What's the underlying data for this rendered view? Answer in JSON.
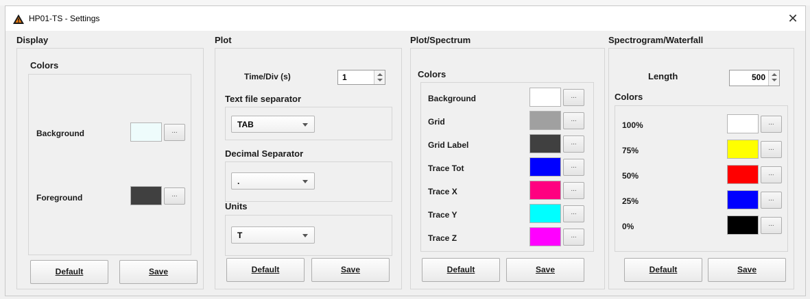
{
  "window": {
    "title": "HP01-TS - Settings",
    "close_glyph": "✕",
    "icon": "warning-triangle-app-icon"
  },
  "display": {
    "title": "Display",
    "colors_label": "Colors",
    "background_label": "Background",
    "background_color": "#eefcfc",
    "foreground_label": "Foreground",
    "foreground_color": "#404040",
    "dots": "...",
    "default_label": "Default",
    "save_label": "Save"
  },
  "plot": {
    "title": "Plot",
    "timediv_label": "Time/Div (s)",
    "timediv_value": "1",
    "text_sep_label": "Text file separator",
    "text_sep_value": "TAB",
    "decimal_sep_label": "Decimal Separator",
    "decimal_sep_value": ".",
    "units_label": "Units",
    "units_value": "T",
    "default_label": "Default",
    "save_label": "Save"
  },
  "spectrum": {
    "title": "Plot/Spectrum",
    "colors_label": "Colors",
    "rows": [
      {
        "label": "Background",
        "color": "#ffffff"
      },
      {
        "label": "Grid",
        "color": "#a0a0a0"
      },
      {
        "label": "Grid Label",
        "color": "#404040"
      },
      {
        "label": "Trace Tot",
        "color": "#0000ff"
      },
      {
        "label": "Trace X",
        "color": "#ff0080"
      },
      {
        "label": "Trace Y",
        "color": "#00ffff"
      },
      {
        "label": "Trace Z",
        "color": "#ff00ff"
      }
    ],
    "dots": "...",
    "default_label": "Default",
    "save_label": "Save"
  },
  "spectrogram": {
    "title": "Spectrogram/Waterfall",
    "length_label": "Length",
    "length_value": "500",
    "colors_label": "Colors",
    "rows": [
      {
        "label": "100%",
        "color": "#ffffff"
      },
      {
        "label": "75%",
        "color": "#ffff00"
      },
      {
        "label": "50%",
        "color": "#ff0000"
      },
      {
        "label": "25%",
        "color": "#0000ff"
      },
      {
        "label": "0%",
        "color": "#000000"
      }
    ],
    "dots": "...",
    "default_label": "Default",
    "save_label": "Save"
  }
}
